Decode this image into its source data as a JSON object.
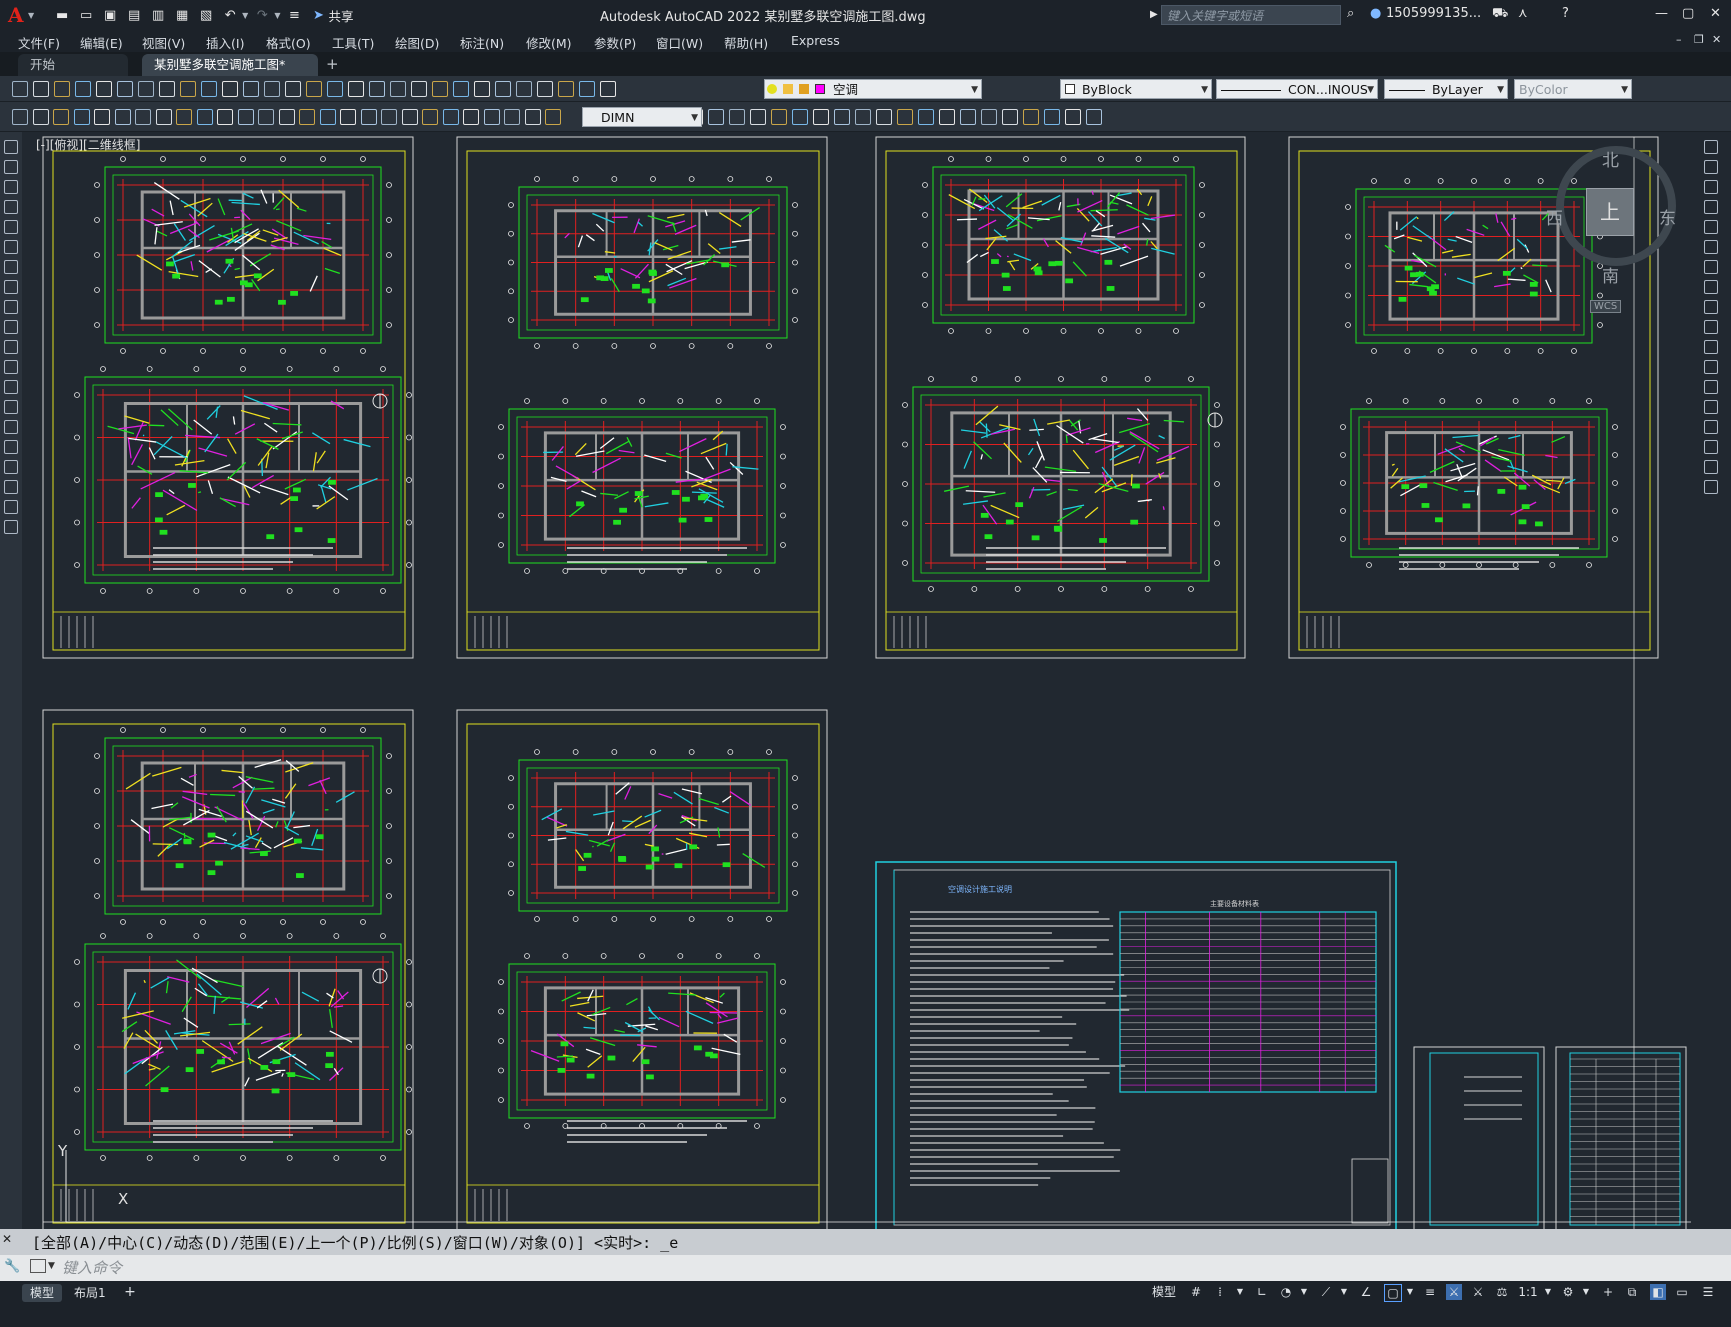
{
  "window": {
    "app_logo": "A",
    "title": "Autodesk AutoCAD 2022    某别墅多联空调施工图.dwg",
    "search_placeholder": "键入关键字或短语",
    "user": "1505999135...",
    "share_label": "共享"
  },
  "menu": [
    "文件(F)",
    "编辑(E)",
    "视图(V)",
    "插入(I)",
    "格式(O)",
    "工具(T)",
    "绘图(D)",
    "标注(N)",
    "修改(M)",
    "参数(P)",
    "窗口(W)",
    "帮助(H)",
    "Express"
  ],
  "tabs": [
    {
      "label": "开始",
      "active": false
    },
    {
      "label": "某别墅多联空调施工图*",
      "active": true
    }
  ],
  "toolbar": {
    "layer_combo": "空调",
    "color_combo": "ByBlock",
    "linetype_combo": "CON...INOUS",
    "lineweight_combo": "ByLayer",
    "plotstyle_combo": "ByColor",
    "dimstyle_combo": "DIMN"
  },
  "viewport": {
    "label": "[-][俯视][二维线框]",
    "compass": {
      "north": "北",
      "south": "南",
      "east": "东",
      "west": "西",
      "top": "上",
      "ucs": "WCS"
    },
    "ucs_y": "Y",
    "ucs_x": "X"
  },
  "command": {
    "history": "[全部(A)/中心(C)/动态(D)/范围(E)/上一个(P)/比例(S)/窗口(W)/对象(O)] <实时>: _e",
    "prompt_placeholder": "键入命令"
  },
  "status": {
    "tabs": [
      "模型",
      "布局1"
    ],
    "model_label": "模型",
    "scale": "1:1"
  },
  "drawing_sheets": [
    {
      "id": "sheet-1",
      "col": 0,
      "row": 0
    },
    {
      "id": "sheet-2",
      "col": 1,
      "row": 0
    },
    {
      "id": "sheet-3",
      "col": 2,
      "row": 0
    },
    {
      "id": "sheet-4",
      "col": 3,
      "row": 0
    },
    {
      "id": "sheet-5",
      "col": 0,
      "row": 1
    },
    {
      "id": "sheet-6",
      "col": 1,
      "row": 1
    }
  ],
  "notes_sheet": {
    "title": "空调设计施工说明",
    "table_title": "主要设备材料表"
  },
  "colors": {
    "frame": "#d4d4d4",
    "inner_frame": "#e0e020",
    "grid_red": "#e02020",
    "dim_green": "#20e020",
    "wall_gray": "#9a9a9a",
    "cyan": "#20d0e0",
    "magenta": "#e020e0",
    "yellow": "#f0e020"
  }
}
